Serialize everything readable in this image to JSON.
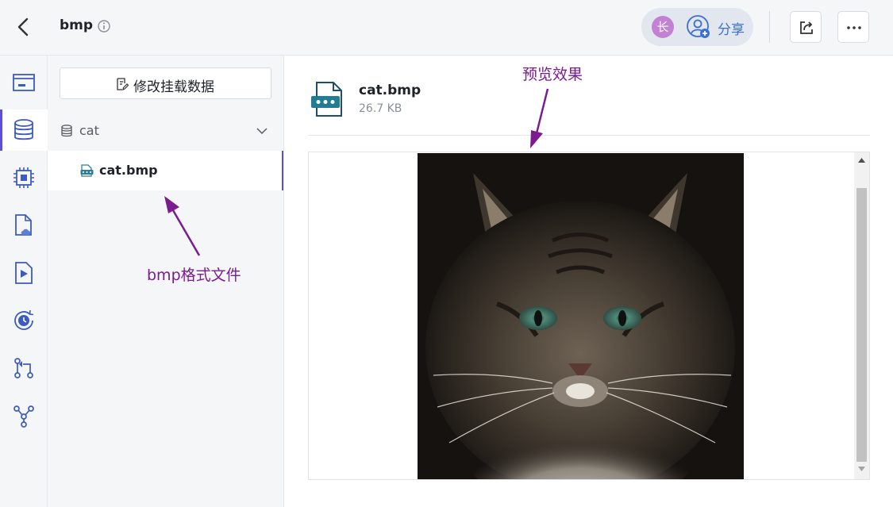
{
  "header": {
    "title": "bmp",
    "avatar_initial": "长",
    "share_label": "分享",
    "icons": {
      "back": "back-arrow-icon",
      "info": "info-icon",
      "share": "add-user-icon",
      "export": "export-icon",
      "more": "more-icon"
    }
  },
  "rail": {
    "items": [
      {
        "icon": "folder-icon"
      },
      {
        "icon": "database-icon",
        "active": true
      },
      {
        "icon": "chip-icon"
      },
      {
        "icon": "cloud-file-icon"
      },
      {
        "icon": "play-file-icon"
      },
      {
        "icon": "history-icon"
      },
      {
        "icon": "merge-icon"
      },
      {
        "icon": "fork-icon"
      }
    ]
  },
  "panel": {
    "edit_mount_label": "修改挂载数据",
    "tree": {
      "folder_label": "cat",
      "file_label": "cat.bmp"
    }
  },
  "preview": {
    "file_name": "cat.bmp",
    "file_size": "26.7 KB",
    "image_alt_icon": "cat-photo"
  },
  "annotations": {
    "preview_effect": "预览效果",
    "bmp_file": "bmp格式文件"
  },
  "colors": {
    "accent": "#5b4fd6",
    "share_blue": "#3b6fd8",
    "annotation": "#7a1b8f",
    "avatar": "#c281d3"
  }
}
